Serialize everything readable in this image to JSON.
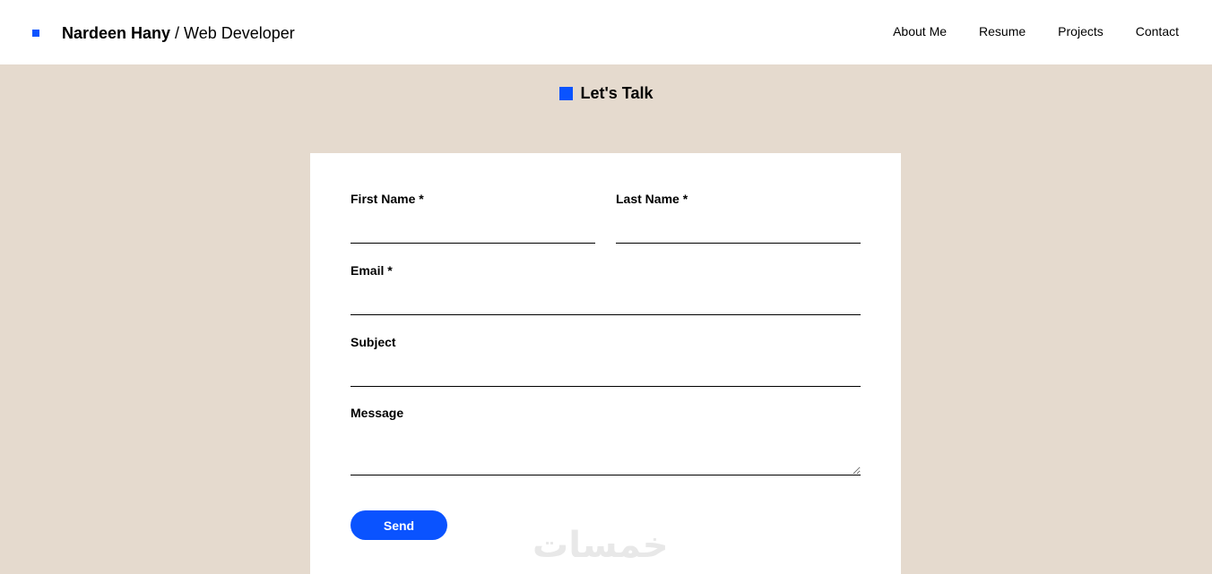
{
  "header": {
    "brand_name": "Nardeen Hany",
    "brand_role": " / Web Developer",
    "nav": [
      {
        "label": "About Me"
      },
      {
        "label": "Resume"
      },
      {
        "label": "Projects"
      },
      {
        "label": "Contact"
      }
    ]
  },
  "section": {
    "title": "Let's Talk"
  },
  "form": {
    "first_name_label": "First Name *",
    "last_name_label": "Last Name *",
    "email_label": "Email *",
    "subject_label": "Subject",
    "message_label": "Message",
    "send_label": "Send"
  },
  "watermark": "خمسات",
  "colors": {
    "accent": "#0a53ff",
    "page_background": "#e5dace",
    "card_background": "#ffffff"
  }
}
